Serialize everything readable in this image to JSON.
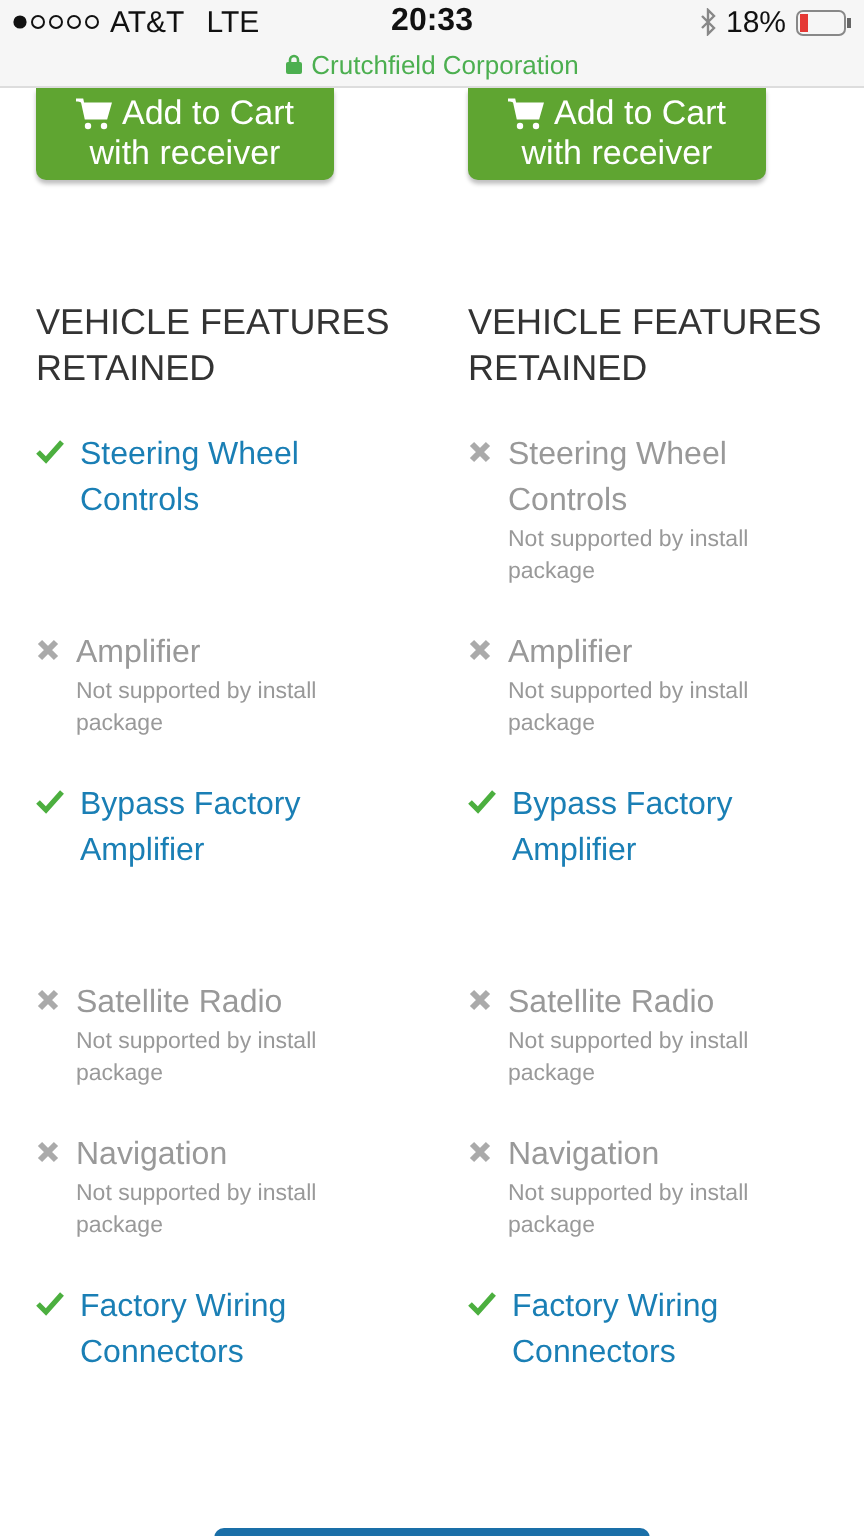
{
  "status_bar": {
    "carrier": "AT&T",
    "network": "LTE",
    "time": "20:33",
    "battery": "18%",
    "site": "Crutchfield Corporation"
  },
  "columns": [
    {
      "button": {
        "line1": "Add to Cart",
        "line2": "with receiver"
      },
      "heading": "VEHICLE FEATURES RETAINED",
      "features": [
        {
          "name": "Steering Wheel Controls",
          "supported": true
        },
        {
          "name": "Amplifier",
          "supported": false,
          "note": "Not supported by install package"
        },
        {
          "name": "Bypass Factory Amplifier",
          "supported": true
        },
        {
          "name": "Satellite Radio",
          "supported": false,
          "note": "Not supported by install package"
        },
        {
          "name": "Navigation",
          "supported": false,
          "note": "Not supported by install package"
        },
        {
          "name": "Factory Wiring Connectors",
          "supported": true
        }
      ]
    },
    {
      "button": {
        "line1": "Add to Cart",
        "line2": "with receiver"
      },
      "heading": "VEHICLE FEATURES RETAINED",
      "features": [
        {
          "name": "Steering Wheel Controls",
          "supported": false,
          "note": "Not supported by install package"
        },
        {
          "name": "Amplifier",
          "supported": false,
          "note": "Not supported by install package"
        },
        {
          "name": "Bypass Factory Amplifier",
          "supported": true
        },
        {
          "name": "Satellite Radio",
          "supported": false,
          "note": "Not supported by install package"
        },
        {
          "name": "Navigation",
          "supported": false,
          "note": "Not supported by install package"
        },
        {
          "name": "Factory Wiring Connectors",
          "supported": true
        }
      ]
    }
  ]
}
